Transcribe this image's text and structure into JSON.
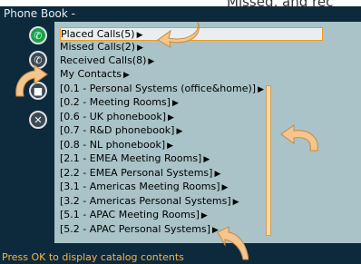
{
  "caption": "Missed, and rec",
  "window_title": "Phone Book -",
  "entries": [
    {
      "label": "Placed Calls(5)"
    },
    {
      "label": "Missed Calls(2)"
    },
    {
      "label": "Received Calls(8)"
    },
    {
      "label": "My Contacts"
    },
    {
      "label": "[0.1 - Personal Systems (office&home)]"
    },
    {
      "label": "[0.2 - Meeting Rooms]"
    },
    {
      "label": "[0.6 - UK phonebook]"
    },
    {
      "label": "[0.7 - R&D phonebook]"
    },
    {
      "label": "[0.8 - NL phonebook]"
    },
    {
      "label": "[2.1 - EMEA Meeting Rooms]"
    },
    {
      "label": "[2.2 - EMEA Personal Systems]"
    },
    {
      "label": "[3.1 - Americas Meeting Rooms]"
    },
    {
      "label": "[3.2 - Americas Personal Systems]"
    },
    {
      "label": "[5.1 - APAC Meeting Rooms]"
    },
    {
      "label": "[5.2 - APAC Personal Systems]"
    }
  ],
  "status_text": "Press OK to display catalog contents",
  "colors": {
    "screen_bg": "#0d2a3d",
    "panel_bg": "#a9c3c8",
    "selection_border": "#f29a1b",
    "status_text": "#ffb238",
    "callout_arrow": "#f4c58c"
  },
  "icons": [
    "call-icon",
    "missed-call-icon",
    "received-call-icon",
    "contacts-icon"
  ]
}
